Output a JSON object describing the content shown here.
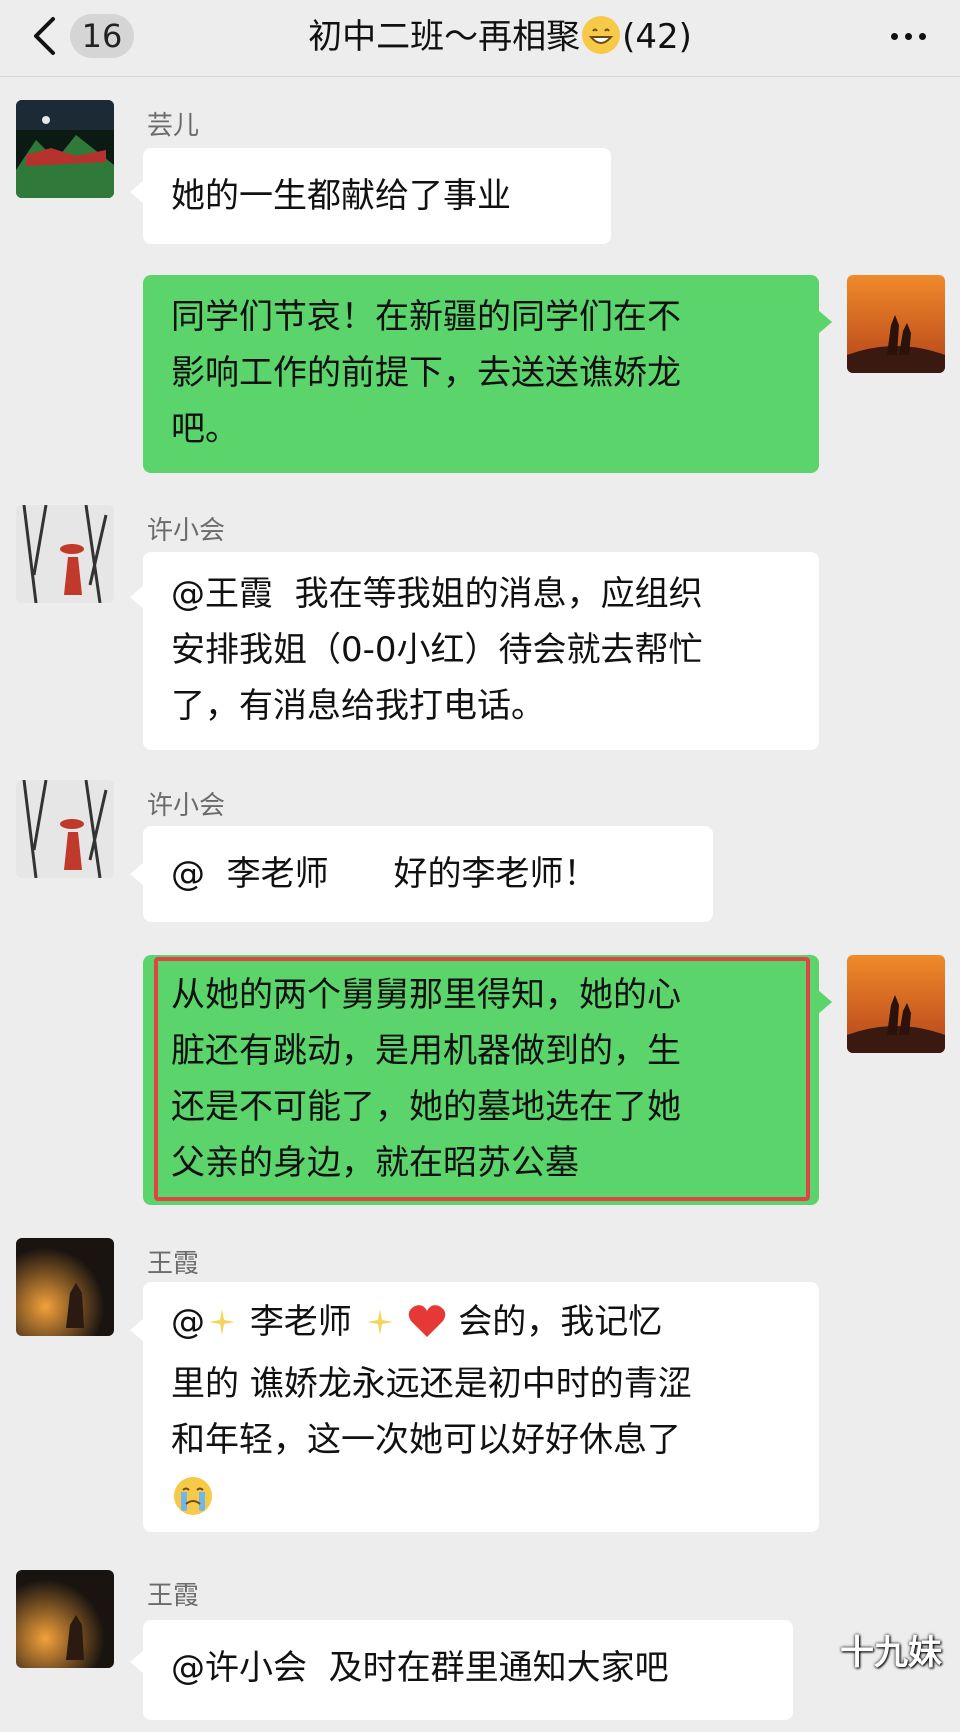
{
  "header": {
    "unread_count": "16",
    "title": "初中二班～再相聚",
    "member_count": "(42)"
  },
  "messages": [
    {
      "sender": "芸儿",
      "text": "她的一生都献给了事业"
    },
    {
      "text": "同学们节哀！在新疆的同学们在不\n影响工作的前提下，去送送谯娇龙\n吧。"
    },
    {
      "sender": "许小会",
      "text": "@王霞  我在等我姐的消息，应组织\n安排我姐（0-0小红）待会就去帮忙\n了，有消息给我打电话。"
    },
    {
      "sender": "许小会",
      "text": "@  李老师      好的李老师！"
    },
    {
      "text": "从她的两个舅舅那里得知，她的心\n脏还有跳动，是用机器做到的，生\n还是不可能了，她的墓地选在了她\n父亲的身边，就在昭苏公墓"
    },
    {
      "sender": "王霞",
      "line1_prefix": "@",
      "line1_name": "李老师",
      "line1_suffix": "会的，我记忆",
      "rest": "里的 谯娇龙永远还是初中时的青涩\n和年轻，这一次她可以好好休息了"
    },
    {
      "sender": "王霞",
      "text": "@许小会  及时在群里通知大家吧"
    }
  ],
  "watermark": "十九妹",
  "colors": {
    "outgoing_bubble": "#5ad46b",
    "incoming_bubble": "#ffffff",
    "background": "#ededed",
    "highlight": "#e04545"
  }
}
